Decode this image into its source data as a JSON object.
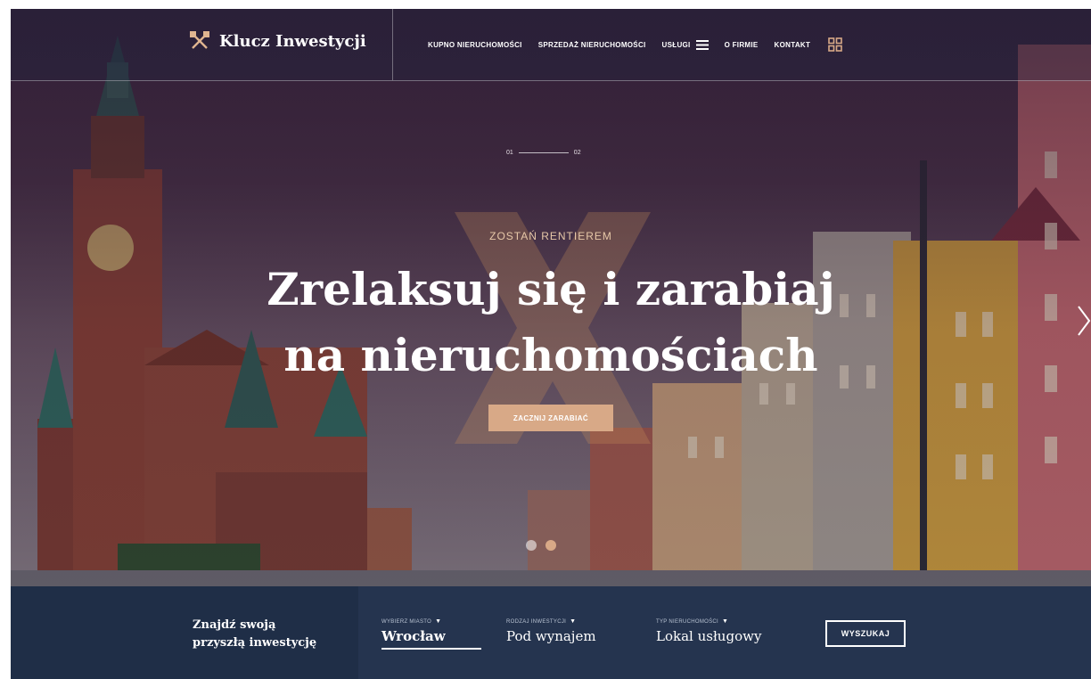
{
  "header": {
    "logo_text": "Klucz Inwestycji",
    "nav": [
      "KUPNO NIERUCHOMOŚCI",
      "SPRZEDAŻ NIERUCHOMOŚCI",
      "USŁUGI",
      "O FIRMIE",
      "KONTAKT"
    ]
  },
  "slider": {
    "counter_current": "01",
    "counter_total": "02",
    "eyebrow": "ZOSTAŃ RENTIEREM",
    "headline_line1": "Zrelaksuj się i zarabiaj",
    "headline_line2": "na nieruchomościach",
    "cta_label": "ZACZNIJ ZARABIAĆ",
    "dots": 2,
    "active_dot": 2
  },
  "search": {
    "title_line1": "Znajdź swoją",
    "title_line2": "przyszłą inwestycję",
    "fields": [
      {
        "label": "WYBIERZ MIASTO",
        "value": "Wrocław"
      },
      {
        "label": "RODZAJ INWESTYCJI",
        "value": "Pod wynajem"
      },
      {
        "label": "TYP NIERUCHOMOŚCI",
        "value": "Lokal usługowy"
      }
    ],
    "button_label": "WYSZUKAJ"
  },
  "colors": {
    "accent": "#d8a987",
    "searchbar": "#25344f",
    "header_overlay": "#1c223c"
  }
}
